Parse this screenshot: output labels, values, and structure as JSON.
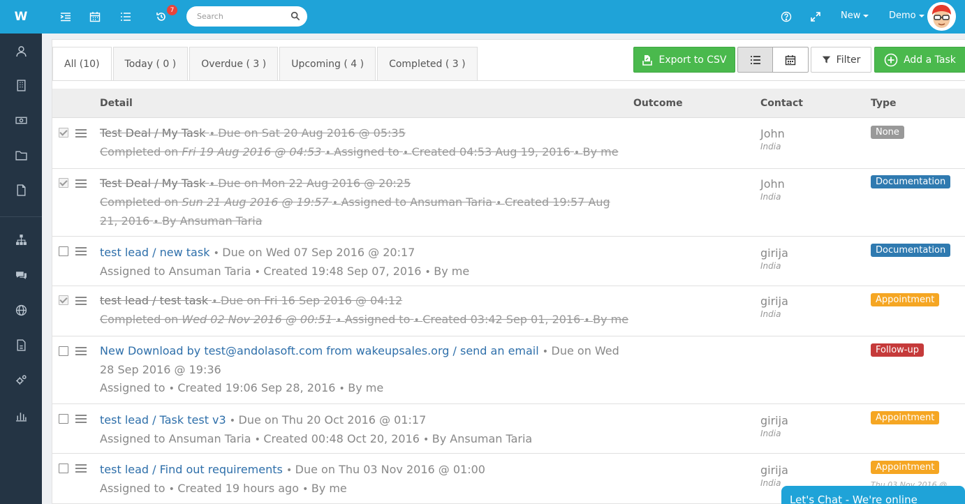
{
  "app": {
    "logo": "W"
  },
  "colors": {
    "brand": "#1fa3d8",
    "sidebar": "#243444",
    "success": "#4ab94d"
  },
  "sidebar": {
    "items": [
      {
        "icon": "user-icon"
      },
      {
        "icon": "building-icon"
      },
      {
        "icon": "money-icon"
      },
      {
        "icon": "folder-icon"
      },
      {
        "icon": "file-icon"
      },
      {
        "icon": "org-chart-icon"
      },
      {
        "icon": "comments-icon"
      },
      {
        "icon": "globe-icon"
      },
      {
        "icon": "document-icon"
      },
      {
        "icon": "gears-icon"
      },
      {
        "icon": "bar-chart-icon"
      }
    ]
  },
  "topbar": {
    "notification_count": "7",
    "search_placeholder": "Search",
    "new_label": "New",
    "user_label": "Demo"
  },
  "tabs": [
    {
      "label": "All (10)"
    },
    {
      "label": "Today ( 0 )"
    },
    {
      "label": "Overdue ( 3 )"
    },
    {
      "label": "Upcoming ( 4 )"
    },
    {
      "label": "Completed ( 3 )"
    }
  ],
  "toolbar": {
    "export_label": "Export to CSV",
    "filter_label": "Filter",
    "add_label": "Add a Task"
  },
  "table": {
    "headers": {
      "detail": "Detail",
      "outcome": "Outcome",
      "contact": "Contact",
      "type": "Type"
    },
    "rows": [
      {
        "done": true,
        "title": "Test Deal / My Task",
        "due": "Due on  Sat 20 Aug 2016 @ 05:35",
        "completed_label": "Completed on",
        "completed_at": "Fri 19 Aug 2016 @ 04:53",
        "assigned": "Assigned to",
        "created": "Created 04:53 Aug 19, 2016",
        "by": "By me",
        "contact": "John",
        "country": "India",
        "type": "None",
        "type_style": "none"
      },
      {
        "done": true,
        "title": "Test Deal / My Task",
        "due": "Due on  Mon 22 Aug 2016 @ 20:25",
        "completed_label": "Completed on",
        "completed_at": "Sun 21 Aug 2016 @ 19:57",
        "assigned": "Assigned to Ansuman Taria",
        "created": "Created 19:57 Aug 21, 2016",
        "by": "By Ansuman Taria",
        "contact": "John",
        "country": "India",
        "type": "Documentation",
        "type_style": "doc"
      },
      {
        "done": false,
        "title": "test lead / new task",
        "due": "Due on  Wed 07 Sep 2016 @ 20:17",
        "assigned": "Assigned to Ansuman Taria",
        "created": "Created 19:48 Sep 07, 2016",
        "by": "By me",
        "contact": "girija",
        "country": "India",
        "type": "Documentation",
        "type_style": "doc"
      },
      {
        "done": true,
        "title": "test lead / test task",
        "due": "Due on  Fri 16 Sep 2016 @ 04:12",
        "completed_label": "Completed on",
        "completed_at": "Wed 02 Nov 2016 @ 00:51",
        "assigned": "Assigned to",
        "created": "Created 03:42 Sep 01, 2016",
        "by": "By me",
        "contact": "girija",
        "country": "India",
        "type": "Appointment",
        "type_style": "app"
      },
      {
        "done": false,
        "title": "New Download by test@andolasoft.com from wakeupsales.org / send an email",
        "due": "Due on  Wed 28 Sep 2016 @ 19:36",
        "assigned": "Assigned to",
        "created": "Created 19:06 Sep 28, 2016",
        "by": "By me",
        "contact": "",
        "country": "",
        "type": "Follow-up",
        "type_style": "follow"
      },
      {
        "done": false,
        "title": "test lead / Task test v3",
        "due": "Due on  Thu 20 Oct 2016 @ 01:17",
        "assigned": "Assigned to Ansuman Taria",
        "created": "Created 00:48 Oct 20, 2016",
        "by": "By Ansuman Taria",
        "contact": "girija",
        "country": "India",
        "type": "Appointment",
        "type_style": "app"
      },
      {
        "done": false,
        "title": "test lead / Find out requirements",
        "due": "Due on  Thu 03 Nov 2016 @ 01:00",
        "assigned": "Assigned to",
        "created": "Created 19 hours ago",
        "by": "By me",
        "contact": "girija",
        "country": "India",
        "type": "Appointment",
        "type_style": "app"
      }
    ],
    "cut_off_date": "Thu 03 Nov 2016 @"
  },
  "chat": {
    "label": "Let's Chat - We're online"
  }
}
